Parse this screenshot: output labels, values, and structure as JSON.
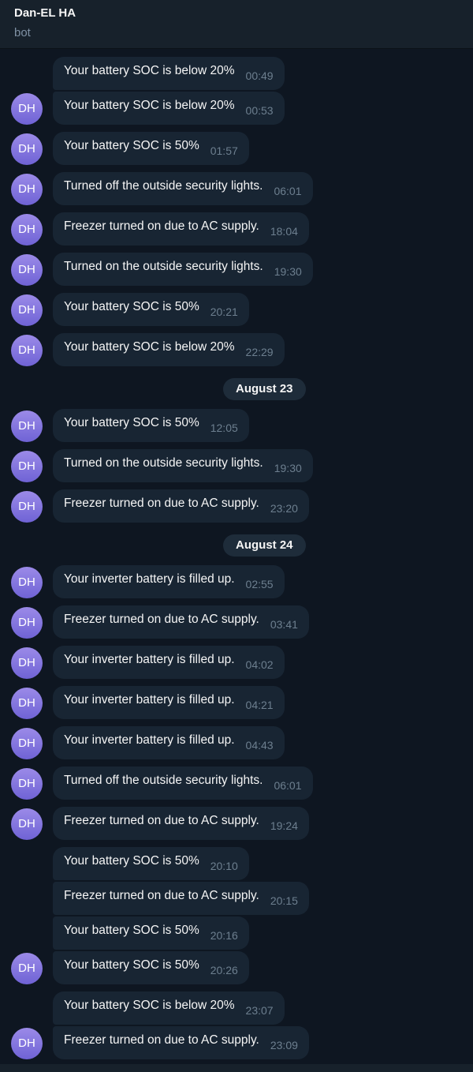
{
  "chat": {
    "name": "Dan-EL HA",
    "status": "bot"
  },
  "avatar_initials": "DH",
  "items": [
    {
      "type": "msg",
      "text": "Your battery SOC is below 20%",
      "time": "00:49",
      "avatar": false
    },
    {
      "type": "msg",
      "text": "Your battery SOC is below 20%",
      "time": "00:53",
      "avatar": true
    },
    {
      "type": "msg",
      "text": "Your battery SOC is 50%",
      "time": "01:57",
      "avatar": true
    },
    {
      "type": "msg",
      "text": "Turned off the outside security lights.",
      "time": "06:01",
      "avatar": true
    },
    {
      "type": "msg",
      "text": "Freezer turned on due to AC supply.",
      "time": "18:04",
      "avatar": true
    },
    {
      "type": "msg",
      "text": "Turned on the outside security lights.",
      "time": "19:30",
      "avatar": true
    },
    {
      "type": "msg",
      "text": "Your battery SOC is 50%",
      "time": "20:21",
      "avatar": true
    },
    {
      "type": "msg",
      "text": "Your battery SOC is below 20%",
      "time": "22:29",
      "avatar": true
    },
    {
      "type": "date",
      "text": "August 23"
    },
    {
      "type": "msg",
      "text": "Your battery SOC is 50%",
      "time": "12:05",
      "avatar": true
    },
    {
      "type": "msg",
      "text": "Turned on the outside security lights.",
      "time": "19:30",
      "avatar": true
    },
    {
      "type": "msg",
      "text": "Freezer turned on due to AC supply.",
      "time": "23:20",
      "avatar": true
    },
    {
      "type": "date",
      "text": "August 24"
    },
    {
      "type": "msg",
      "text": "Your inverter battery is filled up.",
      "time": "02:55",
      "avatar": true
    },
    {
      "type": "msg",
      "text": "Freezer turned on due to AC supply.",
      "time": "03:41",
      "avatar": true
    },
    {
      "type": "msg",
      "text": "Your inverter battery is filled up.",
      "time": "04:02",
      "avatar": true
    },
    {
      "type": "msg",
      "text": "Your inverter battery is filled up.",
      "time": "04:21",
      "avatar": true
    },
    {
      "type": "msg",
      "text": "Your inverter battery is filled up.",
      "time": "04:43",
      "avatar": true
    },
    {
      "type": "msg",
      "text": "Turned off the outside security lights.",
      "time": "06:01",
      "avatar": true
    },
    {
      "type": "msg",
      "text": "Freezer turned on due to AC supply.",
      "time": "19:24",
      "avatar": true
    },
    {
      "type": "msg",
      "text": "Your battery SOC is 50%",
      "time": "20:10",
      "avatar": false
    },
    {
      "type": "msg",
      "text": "Freezer turned on due to AC supply.",
      "time": "20:15",
      "avatar": false
    },
    {
      "type": "msg",
      "text": "Your battery SOC is 50%",
      "time": "20:16",
      "avatar": false
    },
    {
      "type": "msg",
      "text": "Your battery SOC is 50%",
      "time": "20:26",
      "avatar": true
    },
    {
      "type": "msg",
      "text": "Your battery SOC is below 20%",
      "time": "23:07",
      "avatar": false
    },
    {
      "type": "msg",
      "text": "Freezer turned on due to AC supply.",
      "time": "23:09",
      "avatar": true
    }
  ]
}
